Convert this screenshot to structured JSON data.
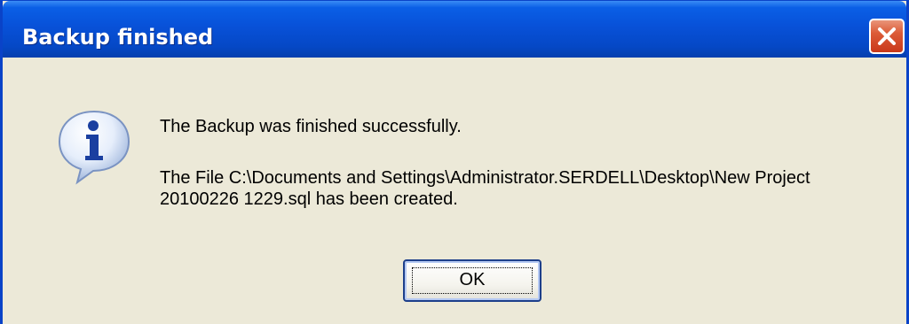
{
  "dialog": {
    "title": "Backup finished",
    "close_icon": "close-icon",
    "info_icon": "info-icon",
    "message_line1": "The Backup was finished successfully.",
    "message_line2": "The File C:\\Documents and Settings\\Administrator.SERDELL\\Desktop\\New Project 20100226 1229.sql has been created.",
    "ok_label": "OK"
  },
  "colors": {
    "titlebar": "#0851d8",
    "window_border": "#0a43c8",
    "body_background": "#ece9d8",
    "close_button": "#dc5b37",
    "ok_button_border": "#1d3f8a"
  }
}
